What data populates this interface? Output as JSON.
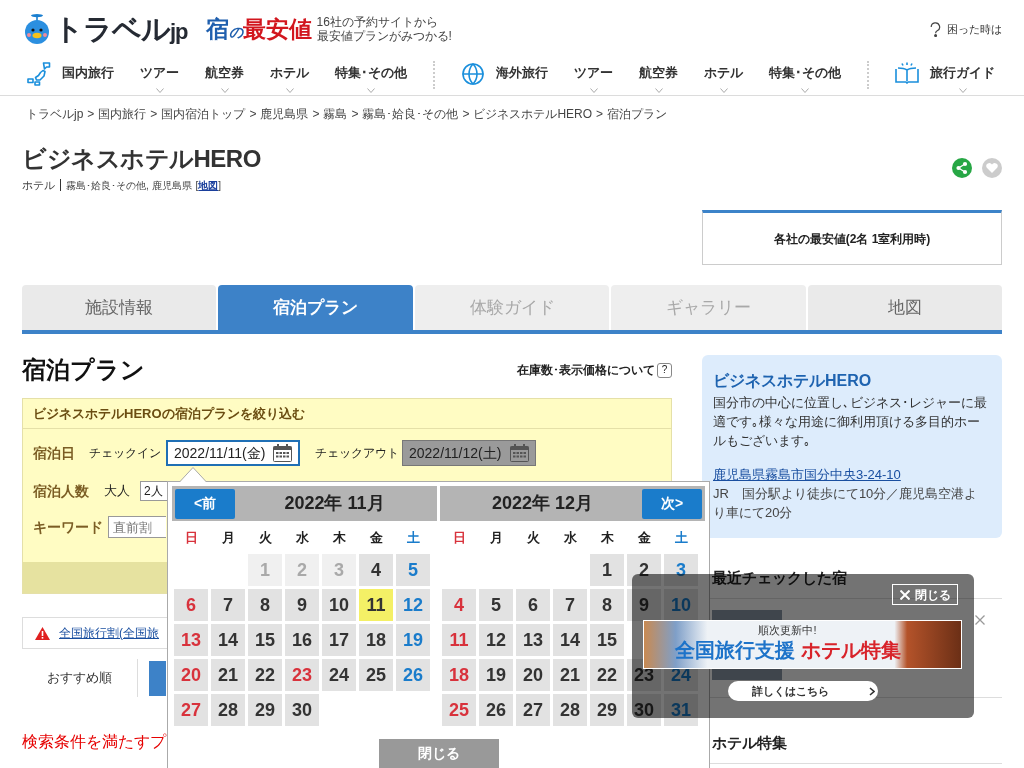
{
  "header": {
    "logo": {
      "text": "トラベル",
      "suffix": "jp"
    },
    "rate_logo": [
      {
        "text": "宿",
        "color": "#1f5fae",
        "kind": "big"
      },
      {
        "text": "の",
        "color": "#1f5fae",
        "kind": "small"
      },
      {
        "text": "最安値",
        "color": "#d2161e",
        "kind": "big"
      }
    ],
    "tagline": [
      "16社の予約サイトから",
      "最安値プランがみつかる!"
    ],
    "help": "困った時は"
  },
  "nav": [
    {
      "kind": "section",
      "label": "国内旅行",
      "dropdown": false
    },
    {
      "kind": "link",
      "label": "ツアー",
      "dropdown": true
    },
    {
      "kind": "link",
      "label": "航空券",
      "dropdown": true
    },
    {
      "kind": "link",
      "label": "ホテル",
      "dropdown": true
    },
    {
      "kind": "link",
      "label": "特集･その他",
      "dropdown": true
    },
    {
      "kind": "divider"
    },
    {
      "kind": "section",
      "label": "海外旅行",
      "dropdown": false
    },
    {
      "kind": "link",
      "label": "ツアー",
      "dropdown": true
    },
    {
      "kind": "link",
      "label": "航空券",
      "dropdown": true
    },
    {
      "kind": "link",
      "label": "ホテル",
      "dropdown": true
    },
    {
      "kind": "link",
      "label": "特集･その他",
      "dropdown": true
    },
    {
      "kind": "divider"
    },
    {
      "kind": "section",
      "label": "旅行ガイド",
      "dropdown": true
    }
  ],
  "breadcrumb": [
    {
      "label": "トラベルjp",
      "separator": ">"
    },
    {
      "label": "国内旅行",
      "separator": ">"
    },
    {
      "label": "国内宿泊トップ",
      "separator": ">"
    },
    {
      "label": "鹿児島県",
      "separator": ">"
    },
    {
      "label": "霧島",
      "separator": ">"
    },
    {
      "label": "霧島･姶良･その他",
      "separator": ">"
    },
    {
      "label": "ビジネスホテルHERO",
      "separator": ">"
    },
    {
      "label": "宿泊プラン"
    }
  ],
  "hotel": {
    "name": "ビジネスホテルHERO",
    "category": "ホテル",
    "area": "霧島･姶良･その他, 鹿児島県",
    "map_open": "[",
    "map_link": "地図",
    "map_close": "]",
    "price_title": "各社の最安値(2名 1室利用時)"
  },
  "tabs": [
    {
      "label": "施設情報",
      "selected": false,
      "disabled": false
    },
    {
      "label": "宿泊プラン",
      "selected": true,
      "disabled": false
    },
    {
      "label": "体験ガイド",
      "selected": false,
      "disabled": true
    },
    {
      "label": "ギャラリー",
      "selected": false,
      "disabled": true
    },
    {
      "label": "地図",
      "selected": false,
      "disabled": false
    }
  ],
  "plans": {
    "heading": "宿泊プラン",
    "stock_note": "在庫数･表示価格について",
    "help_mark": "?"
  },
  "filter": {
    "title": "ビジネスホテルHEROの宿泊プランを絞り込む",
    "date_label": "宿泊日",
    "checkin_label": "チェックイン",
    "checkin": {
      "value": "2022/11/11(金)",
      "active": true
    },
    "checkout_label": "チェックアウト",
    "checkout": {
      "value": "2022/11/12(土)",
      "active": false
    },
    "guests_label": "宿泊人数",
    "adults_label": "大人",
    "adults": "2人",
    "keyword_label": "キーワード",
    "keyword_placeholder": "直前割"
  },
  "notice": {
    "text": "全国旅行割(全国旅"
  },
  "sort": [
    {
      "label": "おすすめ順",
      "selected": false
    },
    {
      "selected": true
    }
  ],
  "result_message": "検索条件を満たすプ",
  "calendar": {
    "months": [
      {
        "title": "2022年 11月",
        "nav": "<前",
        "kind": "prev",
        "weekdays": [
          {
            "label": "日",
            "kind": "sun"
          },
          {
            "label": "月",
            "kind": "day"
          },
          {
            "label": "火",
            "kind": "day"
          },
          {
            "label": "水",
            "kind": "day"
          },
          {
            "label": "木",
            "kind": "day"
          },
          {
            "label": "金",
            "kind": "day"
          },
          {
            "label": "土",
            "kind": "sat"
          }
        ],
        "weeks": [
          {
            "kind": "first",
            "days": [
              {
                "day": "1",
                "kind": "past",
                "selected": false
              },
              {
                "day": "2",
                "kind": "past",
                "selected": false
              },
              {
                "day": "3",
                "kind": "past",
                "selected": false
              },
              {
                "day": "4",
                "kind": "day",
                "selected": false
              },
              {
                "day": "5",
                "kind": "sat",
                "selected": false
              }
            ]
          },
          {
            "kind": "week",
            "days": [
              {
                "day": "6",
                "kind": "sun",
                "selected": false
              },
              {
                "day": "7",
                "kind": "day",
                "selected": false
              },
              {
                "day": "8",
                "kind": "day",
                "selected": false
              },
              {
                "day": "9",
                "kind": "day",
                "selected": false
              },
              {
                "day": "10",
                "kind": "day",
                "selected": false
              },
              {
                "day": "11",
                "kind": "day",
                "selected": true
              },
              {
                "day": "12",
                "kind": "sat",
                "selected": false
              }
            ]
          },
          {
            "kind": "week",
            "days": [
              {
                "day": "13",
                "kind": "sun",
                "selected": false
              },
              {
                "day": "14",
                "kind": "day",
                "selected": false
              },
              {
                "day": "15",
                "kind": "day",
                "selected": false
              },
              {
                "day": "16",
                "kind": "day",
                "selected": false
              },
              {
                "day": "17",
                "kind": "day",
                "selected": false
              },
              {
                "day": "18",
                "kind": "day",
                "selected": false
              },
              {
                "day": "19",
                "kind": "sat",
                "selected": false
              }
            ]
          },
          {
            "kind": "week",
            "days": [
              {
                "day": "20",
                "kind": "sun",
                "selected": false
              },
              {
                "day": "21",
                "kind": "day",
                "selected": false
              },
              {
                "day": "22",
                "kind": "day",
                "selected": false
              },
              {
                "day": "23",
                "kind": "holiday",
                "selected": false
              },
              {
                "day": "24",
                "kind": "day",
                "selected": false
              },
              {
                "day": "25",
                "kind": "day",
                "selected": false
              },
              {
                "day": "26",
                "kind": "sat",
                "selected": false
              }
            ]
          },
          {
            "kind": "week",
            "days": [
              {
                "day": "27",
                "kind": "sun",
                "selected": false
              },
              {
                "day": "28",
                "kind": "day",
                "selected": false
              },
              {
                "day": "29",
                "kind": "day",
                "selected": false
              },
              {
                "day": "30",
                "kind": "day",
                "selected": false
              }
            ]
          }
        ]
      },
      {
        "title": "2022年 12月",
        "nav": "次>",
        "kind": "next",
        "weekdays": [
          {
            "label": "日",
            "kind": "sun"
          },
          {
            "label": "月",
            "kind": "day"
          },
          {
            "label": "火",
            "kind": "day"
          },
          {
            "label": "水",
            "kind": "day"
          },
          {
            "label": "木",
            "kind": "day"
          },
          {
            "label": "金",
            "kind": "day"
          },
          {
            "label": "土",
            "kind": "sat"
          }
        ],
        "weeks": [
          {
            "kind": "first",
            "days": [
              {
                "day": "1",
                "kind": "day",
                "selected": false
              },
              {
                "day": "2",
                "kind": "day",
                "selected": false
              },
              {
                "day": "3",
                "kind": "sat",
                "selected": false
              }
            ]
          },
          {
            "kind": "week",
            "days": [
              {
                "day": "4",
                "kind": "sun",
                "selected": false
              },
              {
                "day": "5",
                "kind": "day",
                "selected": false
              },
              {
                "day": "6",
                "kind": "day",
                "selected": false
              },
              {
                "day": "7",
                "kind": "day",
                "selected": false
              },
              {
                "day": "8",
                "kind": "day",
                "selected": false
              },
              {
                "day": "9",
                "kind": "day",
                "selected": false
              },
              {
                "day": "10",
                "kind": "sat",
                "selected": false
              }
            ]
          },
          {
            "kind": "week",
            "days": [
              {
                "day": "11",
                "kind": "sun",
                "selected": false
              },
              {
                "day": "12",
                "kind": "day",
                "selected": false
              },
              {
                "day": "13",
                "kind": "day",
                "selected": false
              },
              {
                "day": "14",
                "kind": "day",
                "selected": false
              },
              {
                "day": "15",
                "kind": "day",
                "selected": false
              }
            ]
          },
          {
            "kind": "week",
            "days": [
              {
                "day": "18",
                "kind": "sun",
                "selected": false
              },
              {
                "day": "19",
                "kind": "day",
                "selected": false
              },
              {
                "day": "20",
                "kind": "day",
                "selected": false
              },
              {
                "day": "21",
                "kind": "day",
                "selected": false
              },
              {
                "day": "22",
                "kind": "day",
                "selected": false
              },
              {
                "day": "23",
                "kind": "day",
                "selected": false
              },
              {
                "day": "24",
                "kind": "sat",
                "selected": false
              }
            ]
          },
          {
            "kind": "week",
            "days": [
              {
                "day": "25",
                "kind": "sun",
                "selected": false
              },
              {
                "day": "26",
                "kind": "day",
                "selected": false
              },
              {
                "day": "27",
                "kind": "day",
                "selected": false
              },
              {
                "day": "28",
                "kind": "day",
                "selected": false
              },
              {
                "day": "29",
                "kind": "day",
                "selected": false
              },
              {
                "day": "30",
                "kind": "day",
                "selected": false
              },
              {
                "day": "31",
                "kind": "sat",
                "selected": false
              }
            ]
          }
        ]
      }
    ],
    "close": "閉じる"
  },
  "sidebar": {
    "name": "ビジネスホテルHERO",
    "description": "国分市の中心に位置し､ビジネス･レジャーに最適です｡様々な用途に御利用頂ける多目的ホールもございます｡",
    "address": "鹿児島県霧島市国分中央3-24-10",
    "access": "JR　国分駅より徒歩にて10分／鹿児島空港より車にて20分",
    "recent_heading": "最近チェックした宿",
    "feature_heading": "ホテル特集"
  },
  "ad": {
    "close": "閉じる",
    "tag": "順次更新中!",
    "title": "全国旅行支援",
    "highlight": "ホテル特集",
    "cta": "詳しくはこちら"
  }
}
